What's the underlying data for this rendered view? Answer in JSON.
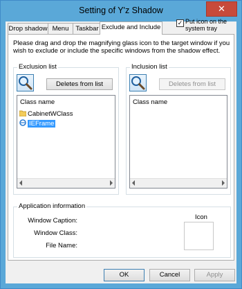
{
  "window": {
    "title": "Setting of Y'z Shadow",
    "close_symbol": "✕"
  },
  "tabs": [
    {
      "label": "Drop shadow"
    },
    {
      "label": "Menu"
    },
    {
      "label": "Taskbar"
    },
    {
      "label": "Exclude and Include",
      "active": true
    }
  ],
  "tray_option": {
    "label_line1": "Put icon on the",
    "label_line2": "system tray",
    "checked_mark": "✓"
  },
  "instructions": "Please drag and drop the magnifying glass icon to the target window if you wish to exclude or include the specific windows from the shadow effect.",
  "exclusion": {
    "title": "Exclusion list",
    "delete_button": "Deletes from list",
    "column": "Class name",
    "items": [
      {
        "name": "CabinetWClass",
        "icon": "folder-icon"
      },
      {
        "name": "IEFrame",
        "icon": "internet-explorer-icon",
        "selected": true
      }
    ]
  },
  "inclusion": {
    "title": "Inclusion list",
    "delete_button": "Deletes from list",
    "column": "Class name"
  },
  "app_info": {
    "title": "Application information",
    "caption_label": "Window Caption:",
    "class_label": "Window Class:",
    "file_label": "File Name:",
    "icon_label": "Icon"
  },
  "buttons": {
    "ok": "OK",
    "cancel": "Cancel",
    "apply": "Apply"
  }
}
